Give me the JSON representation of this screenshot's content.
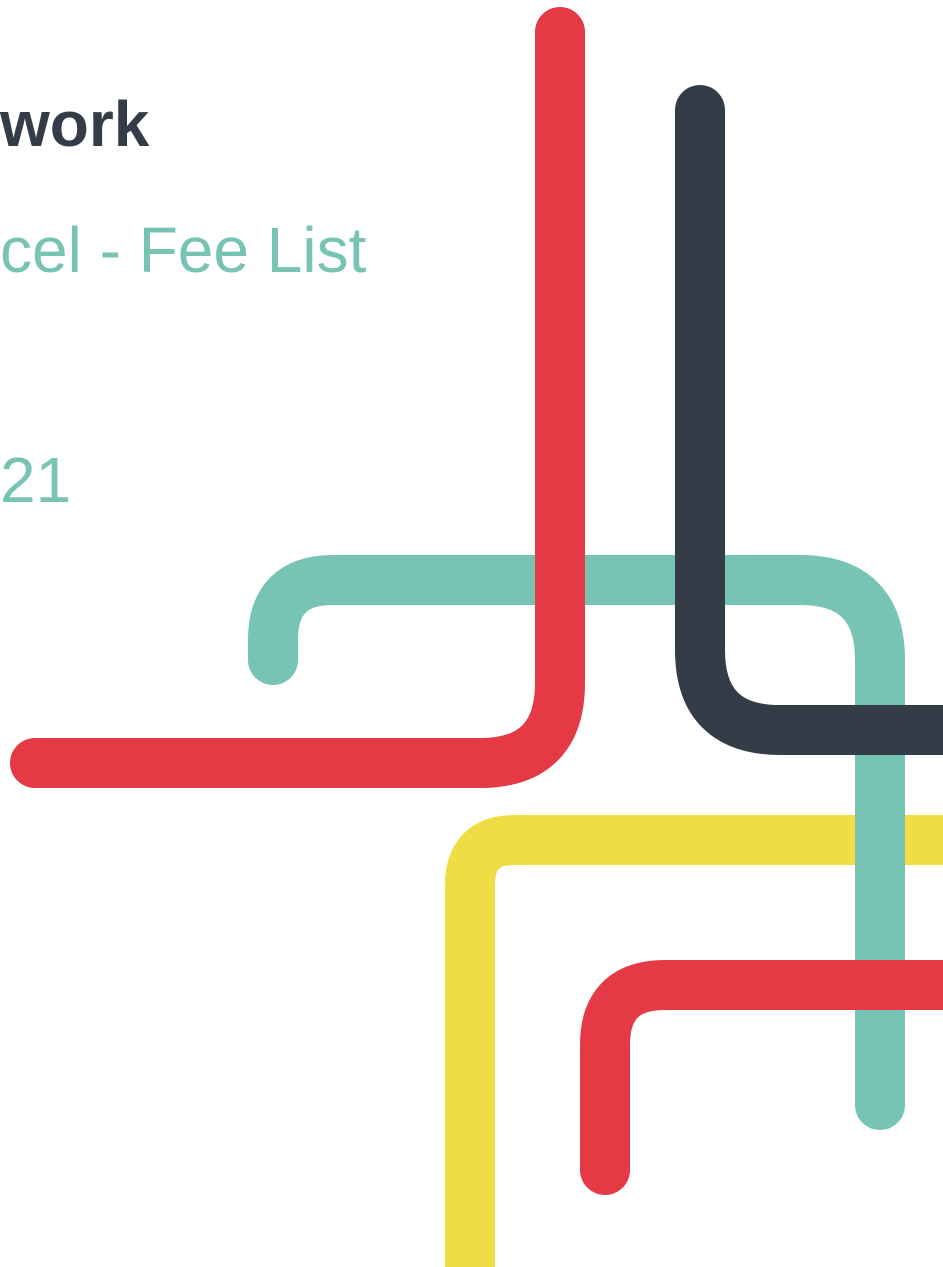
{
  "cover": {
    "title": "work",
    "subtitle": "cel - Fee List",
    "date": "21"
  },
  "colors": {
    "red": "#e63946",
    "dark": "#343d47",
    "teal": "#77c4b4",
    "yellow": "#eedd44"
  }
}
